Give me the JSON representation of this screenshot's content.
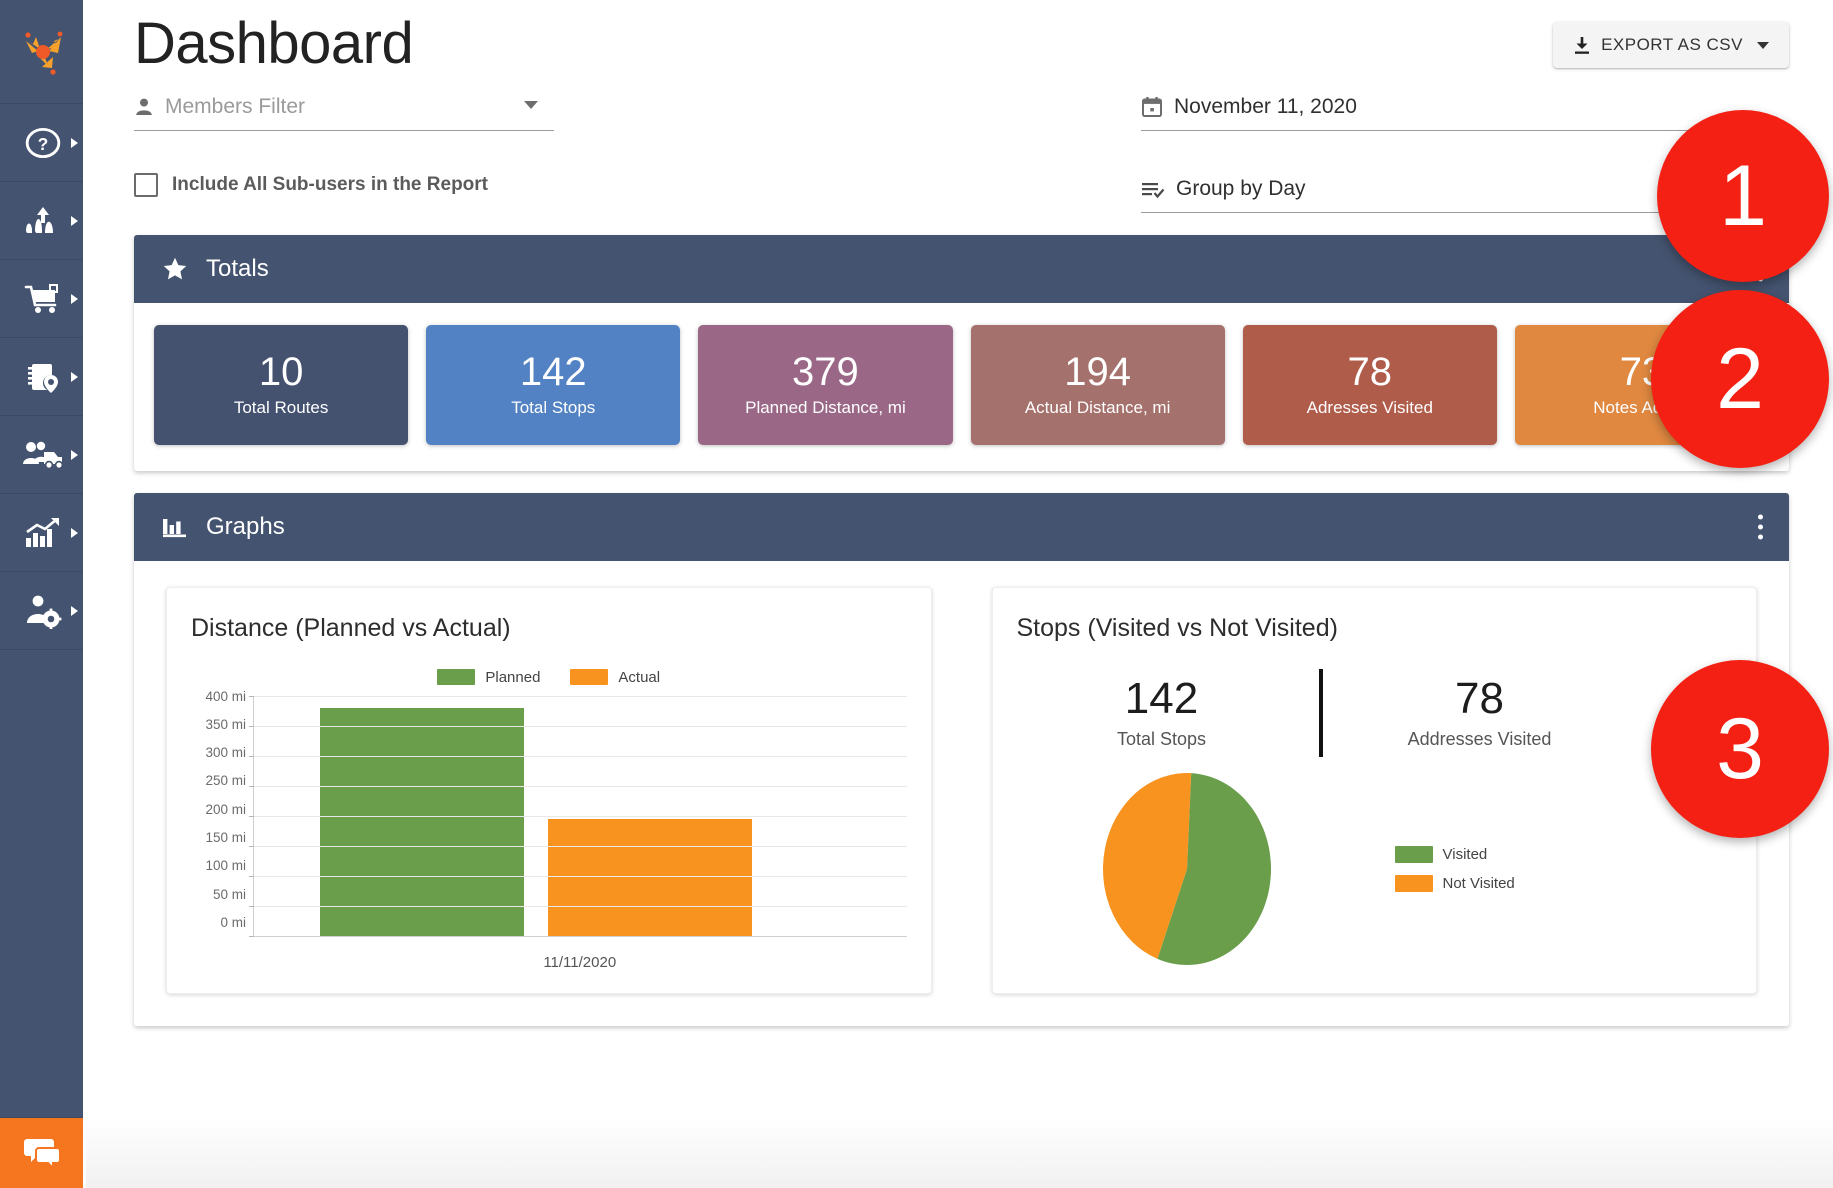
{
  "sidebar": {
    "logo_icon": "route-arrows-logo-icon",
    "items": [
      {
        "icon": "help-circle-icon",
        "name": "help"
      },
      {
        "icon": "routes-icon",
        "name": "routes"
      },
      {
        "icon": "shopping-cart-icon",
        "name": "orders"
      },
      {
        "icon": "address-book-location-icon",
        "name": "address-book"
      },
      {
        "icon": "team-vehicle-icon",
        "name": "team"
      },
      {
        "icon": "analytics-chart-icon",
        "name": "analytics"
      },
      {
        "icon": "user-settings-icon",
        "name": "user-settings"
      }
    ],
    "chat_icon": "chat-bubbles-icon"
  },
  "header": {
    "title": "Dashboard",
    "export_label": "EXPORT AS CSV",
    "export_icon": "download-icon",
    "export_caret_icon": "chevron-down-icon"
  },
  "filters": {
    "members": {
      "placeholder": "Members Filter",
      "icon": "person-icon",
      "caret_icon": "chevron-down-icon"
    },
    "date": {
      "value": "November 11, 2020",
      "icon": "calendar-icon"
    },
    "group_by": {
      "value": "Group by Day",
      "icon": "list-check-icon"
    },
    "include_subusers": {
      "label": "Include All Sub-users in the Report",
      "checked": false
    }
  },
  "totals_panel": {
    "title": "Totals",
    "icon": "star-icon",
    "menu_icon": "kebab-menu-icon",
    "cards": [
      {
        "value": "10",
        "label": "Total Routes",
        "color": "#44516f"
      },
      {
        "value": "142",
        "label": "Total Stops",
        "color": "#5282c3"
      },
      {
        "value": "379",
        "label": "Planned Distance, mi",
        "color": "#9a6787"
      },
      {
        "value": "194",
        "label": "Actual Distance, mi",
        "color": "#a5716c"
      },
      {
        "value": "78",
        "label": "Adresses Visited",
        "color": "#b05c4b"
      },
      {
        "value": "73",
        "label": "Notes Added",
        "color": "#e08840"
      }
    ]
  },
  "graphs_panel": {
    "title": "Graphs",
    "icon": "bar-chart-icon",
    "menu_icon": "kebab-menu-icon"
  },
  "stops_card": {
    "total_stops_value": "142",
    "total_stops_label": "Total Stops",
    "addresses_visited_value": "78",
    "addresses_visited_label": "Addresses Visited"
  },
  "annotations": [
    {
      "label": "1",
      "color": "#f32013"
    },
    {
      "label": "2",
      "color": "#f32013"
    },
    {
      "label": "3",
      "color": "#f32013"
    }
  ],
  "chart_data": [
    {
      "type": "bar",
      "title": "Distance (Planned vs Actual)",
      "categories": [
        "11/11/2020"
      ],
      "series": [
        {
          "name": "Planned",
          "values": [
            379
          ],
          "color": "#6a9e4a"
        },
        {
          "name": "Actual",
          "values": [
            194
          ],
          "color": "#f7931e"
        }
      ],
      "xlabel": "",
      "ylabel": "",
      "ylim": [
        0,
        400
      ],
      "yticks": [
        "400 mi",
        "350 mi",
        "300 mi",
        "250 mi",
        "200 mi",
        "150 mi",
        "100 mi",
        "50 mi",
        "0 mi"
      ],
      "ytick_values": [
        400,
        350,
        300,
        250,
        200,
        150,
        100,
        50,
        0
      ],
      "grid": true,
      "legend_position": "top-center"
    },
    {
      "type": "pie",
      "title": "Stops (Visited vs Not Visited)",
      "labels": [
        "Visited",
        "Not Visited"
      ],
      "values": [
        78,
        64
      ],
      "colors": [
        "#6a9e4a",
        "#f7931e"
      ],
      "legend_position": "right",
      "annotations": {
        "total_stops": 142,
        "addresses_visited": 78
      }
    }
  ]
}
